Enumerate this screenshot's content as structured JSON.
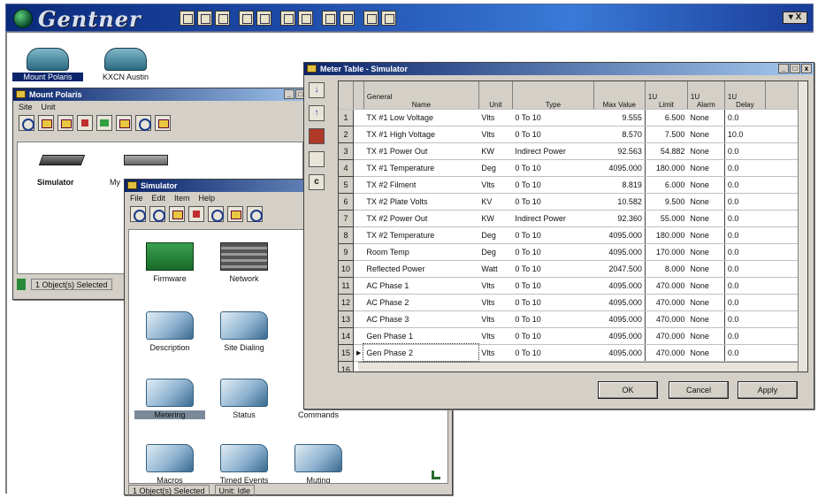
{
  "app": {
    "brand": "Gentner",
    "close_label": "▾ X"
  },
  "sites": [
    {
      "label": "Mount Polaris"
    },
    {
      "label": "KXCN Austin"
    }
  ],
  "mount_window": {
    "title": "Mount Polaris",
    "menu": [
      "Site",
      "Unit"
    ],
    "devices": [
      {
        "label": "Simulator"
      },
      {
        "label": "My"
      }
    ],
    "status": "1 Object(s) Selected"
  },
  "simulator_window": {
    "title": "Simulator",
    "menu": [
      "File",
      "Edit",
      "Item",
      "Help"
    ],
    "items": [
      {
        "label": "Firmware",
        "pic": "firmware"
      },
      {
        "label": "Network",
        "pic": "network"
      },
      {
        "label": "Description",
        "pic": "folder"
      },
      {
        "label": "Site Dialing",
        "pic": "folder"
      },
      {
        "label": "Metering",
        "pic": "folder"
      },
      {
        "label": "Status",
        "pic": "folder"
      },
      {
        "label": "Commands",
        "pic": "none"
      },
      {
        "label": "Macros",
        "pic": "folder"
      },
      {
        "label": "Timed Events",
        "pic": "folder"
      },
      {
        "label": "Muting",
        "pic": "folder"
      }
    ],
    "status_selected": "1 Object(s) Selected",
    "status_unit": "Unit: Idle"
  },
  "meter_table": {
    "title": "Meter Table - Simulator",
    "headers": {
      "general": "General",
      "name": "Name",
      "unit": "Unit",
      "type": "Type",
      "max_value": "Max Value",
      "limit_group": "1U",
      "limit": "Limit",
      "alarm_group": "1U",
      "alarm": "Alarm",
      "delay_group": "1U",
      "delay": "Delay"
    },
    "rows": [
      {
        "n": "1",
        "name": "TX #1 Low Voltage",
        "unit": "Vlts",
        "type": "0 To 10",
        "max": "9.555",
        "limit": "6.500",
        "alarm": "None",
        "delay": "0.0"
      },
      {
        "n": "2",
        "name": "TX #1 High Voltage",
        "unit": "Vlts",
        "type": "0 To 10",
        "max": "8.570",
        "limit": "7.500",
        "alarm": "None",
        "delay": "10.0"
      },
      {
        "n": "3",
        "name": "TX #1 Power Out",
        "unit": "KW",
        "type": "Indirect Power",
        "max": "92.563",
        "limit": "54.882",
        "alarm": "None",
        "delay": "0.0"
      },
      {
        "n": "4",
        "name": "TX #1 Temperature",
        "unit": "Deg",
        "type": "0 To 10",
        "max": "4095.000",
        "limit": "180.000",
        "alarm": "None",
        "delay": "0.0"
      },
      {
        "n": "5",
        "name": "TX #2 Filment",
        "unit": "Vlts",
        "type": "0 To 10",
        "max": "8.819",
        "limit": "6.000",
        "alarm": "None",
        "delay": "0.0"
      },
      {
        "n": "6",
        "name": "TX #2 Plate Volts",
        "unit": "KV",
        "type": "0 To 10",
        "max": "10.582",
        "limit": "9.500",
        "alarm": "None",
        "delay": "0.0"
      },
      {
        "n": "7",
        "name": "TX #2 Power Out",
        "unit": "KW",
        "type": "Indirect Power",
        "max": "92.360",
        "limit": "55.000",
        "alarm": "None",
        "delay": "0.0"
      },
      {
        "n": "8",
        "name": "TX #2 Temperature",
        "unit": "Deg",
        "type": "0 To 10",
        "max": "4095.000",
        "limit": "180.000",
        "alarm": "None",
        "delay": "0.0"
      },
      {
        "n": "9",
        "name": "Room Temp",
        "unit": "Deg",
        "type": "0 To 10",
        "max": "4095.000",
        "limit": "170.000",
        "alarm": "None",
        "delay": "0.0"
      },
      {
        "n": "10",
        "name": "Reflected Power",
        "unit": "Watt",
        "type": "0 To 10",
        "max": "2047.500",
        "limit": "8.000",
        "alarm": "None",
        "delay": "0.0"
      },
      {
        "n": "11",
        "name": "AC Phase 1",
        "unit": "Vlts",
        "type": "0 To 10",
        "max": "4095.000",
        "limit": "470.000",
        "alarm": "None",
        "delay": "0.0"
      },
      {
        "n": "12",
        "name": "AC Phase 2",
        "unit": "Vlts",
        "type": "0 To 10",
        "max": "4095.000",
        "limit": "470.000",
        "alarm": "None",
        "delay": "0.0"
      },
      {
        "n": "13",
        "name": "AC Phase 3",
        "unit": "Vlts",
        "type": "0 To 10",
        "max": "4095.000",
        "limit": "470.000",
        "alarm": "None",
        "delay": "0.0"
      },
      {
        "n": "14",
        "name": "Gen Phase 1",
        "unit": "Vlts",
        "type": "0 To 10",
        "max": "4095.000",
        "limit": "470.000",
        "alarm": "None",
        "delay": "0.0"
      },
      {
        "n": "15",
        "name": "Gen Phase 2",
        "unit": "Vlts",
        "type": "0 To 10",
        "max": "4095.000",
        "limit": "470.000",
        "alarm": "None",
        "delay": "0.0"
      },
      {
        "n": "16",
        "name": "",
        "unit": "",
        "type": "",
        "max": "",
        "limit": "",
        "alarm": "",
        "delay": ""
      }
    ],
    "buttons": {
      "ok": "OK",
      "cancel": "Cancel",
      "apply": "Apply"
    }
  }
}
